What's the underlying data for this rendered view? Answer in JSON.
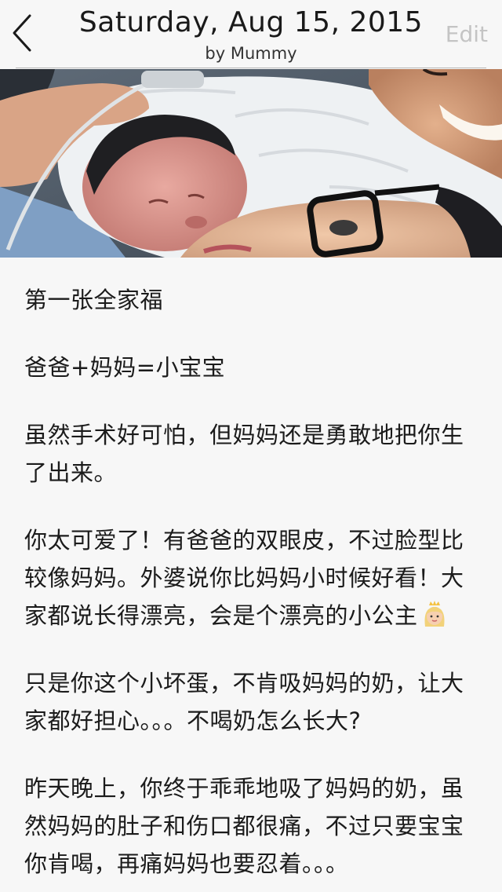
{
  "header": {
    "title": "Saturday, Aug 15, 2015",
    "subtitle": "by Mummy",
    "edit_label": "Edit",
    "back_icon": "chevron-left-icon"
  },
  "photo": {
    "icon": "family-photo"
  },
  "entry": {
    "paragraphs": [
      "第一张全家福",
      "爸爸+妈妈=小宝宝",
      "虽然手术好可怕，但妈妈还是勇敢地把你生了出来。",
      "你太可爱了！有爸爸的双眼皮，不过脸型比较像妈妈。外婆说你比妈妈小时候好看！大家都说长得漂亮，会是个漂亮的小公主",
      "只是你这个小坏蛋，不肯吸妈妈的奶，让大家都好担心。。。不喝奶怎么长大?",
      "昨天晚上，你终于乖乖地吸了妈妈的奶，虽然妈妈的肚子和伤口都很痛，不过只要宝宝你肯喝，再痛妈妈也要忍着。。。"
    ],
    "emoji": "princess-emoji"
  },
  "colors": {
    "background": "#f7f7f7",
    "text": "#1b1b1b",
    "edit_disabled": "#c4c4c4"
  }
}
